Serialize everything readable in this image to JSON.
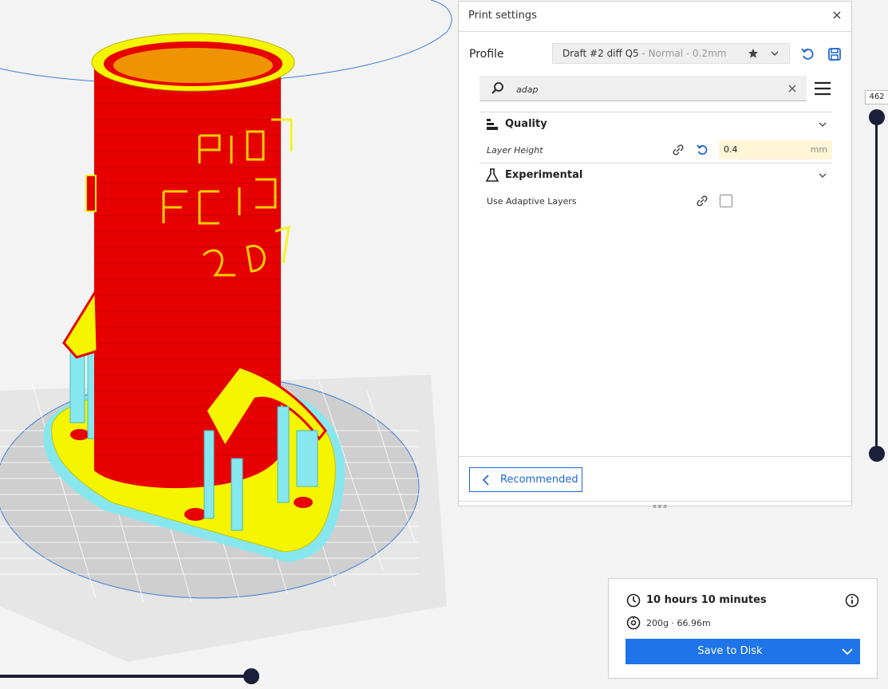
{
  "print_settings": {
    "title": "Print settings",
    "profile": {
      "label": "Profile",
      "name": "Draft #2  diff Q5",
      "meta": " - Normal - 0.2mm"
    },
    "search": {
      "value": "adap"
    },
    "categories": [
      {
        "label": "Quality",
        "icon": "quality-icon",
        "settings": [
          {
            "label": "Layer Height",
            "value": "0.4",
            "unit": "mm"
          }
        ]
      },
      {
        "label": "Experimental",
        "icon": "flask-icon",
        "settings": [
          {
            "label": "Use Adaptive Layers",
            "checked": false
          }
        ]
      }
    ],
    "recommended_label": "Recommended"
  },
  "layer_view": {
    "current_layer": "462"
  },
  "job": {
    "time": "10 hours 10 minutes",
    "material": "200g · 66.96m",
    "save_label": "Save to Disk"
  },
  "colors": {
    "accent": "#1e74e8",
    "wall_outer": "#e60000",
    "wall_inner": "#f5f500",
    "support": "#86e8ee",
    "slider": "#1b1f3b"
  }
}
